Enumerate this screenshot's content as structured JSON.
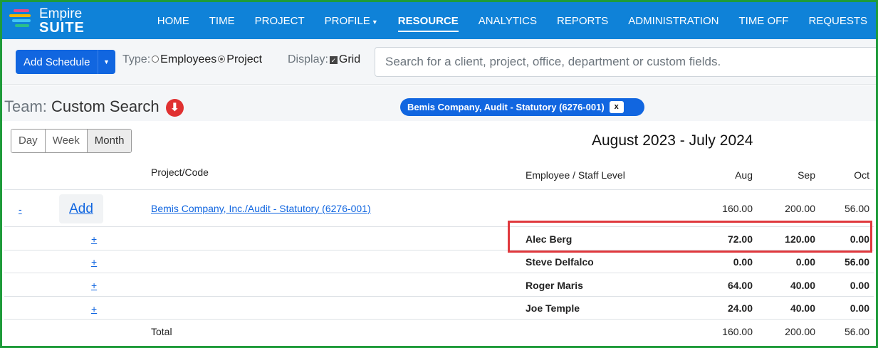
{
  "brand": {
    "name_top": "Empire",
    "name_bottom": "SUITE",
    "bar_colors": [
      "#e84a8a",
      "#f4b400",
      "#41c5f4",
      "#2bbf8a"
    ]
  },
  "nav": {
    "items": [
      {
        "label": "HOME"
      },
      {
        "label": "TIME"
      },
      {
        "label": "PROJECT"
      },
      {
        "label": "PROFILE"
      },
      {
        "label": "RESOURCE"
      },
      {
        "label": "ANALYTICS"
      },
      {
        "label": "REPORTS"
      },
      {
        "label": "ADMINISTRATION"
      },
      {
        "label": "TIME OFF"
      },
      {
        "label": "REQUESTS"
      }
    ],
    "active": "RESOURCE"
  },
  "toolbar": {
    "add_schedule": "Add Schedule",
    "type_label": "Type:",
    "type_opt_employees": "Employees",
    "type_opt_project": "Project",
    "display_label": "Display:",
    "display_grid": "Grid",
    "search_placeholder": "Search for a client, project, office, department or custom fields."
  },
  "team": {
    "label": "Team:",
    "value": "Custom Search",
    "filter_pill": "Bemis Company, Audit - Statutory (6276-001)",
    "filter_remove": "x"
  },
  "range": {
    "views": [
      "Day",
      "Week",
      "Month"
    ],
    "selected": "Month",
    "title": "August 2023 - July 2024"
  },
  "table": {
    "headers": {
      "project": "Project/Code",
      "employee": "Employee / Staff Level",
      "m1": "Aug",
      "m2": "Sep",
      "m3": "Oct"
    },
    "project_row": {
      "collapse": "-",
      "add": "Add",
      "project": "Bemis Company, Inc./Audit - Statutory (6276-001)",
      "m1": "160.00",
      "m2": "200.00",
      "m3": "56.00"
    },
    "employees": [
      {
        "expand": "+",
        "name": "Alec Berg",
        "m1": "72.00",
        "m2": "120.00",
        "m3": "0.00"
      },
      {
        "expand": "+",
        "name": "Steve Delfalco",
        "m1": "0.00",
        "m2": "0.00",
        "m3": "56.00"
      },
      {
        "expand": "+",
        "name": "Roger Maris",
        "m1": "64.00",
        "m2": "40.00",
        "m3": "0.00"
      },
      {
        "expand": "+",
        "name": "Joe Temple",
        "m1": "24.00",
        "m2": "40.00",
        "m3": "0.00"
      }
    ],
    "total": {
      "label": "Total",
      "m1": "160.00",
      "m2": "200.00",
      "m3": "56.00"
    }
  },
  "colors": {
    "nav_bg": "#0f82d8",
    "accent": "#1166e0",
    "highlight": "#e0393e",
    "frame": "#1e9b3a"
  }
}
